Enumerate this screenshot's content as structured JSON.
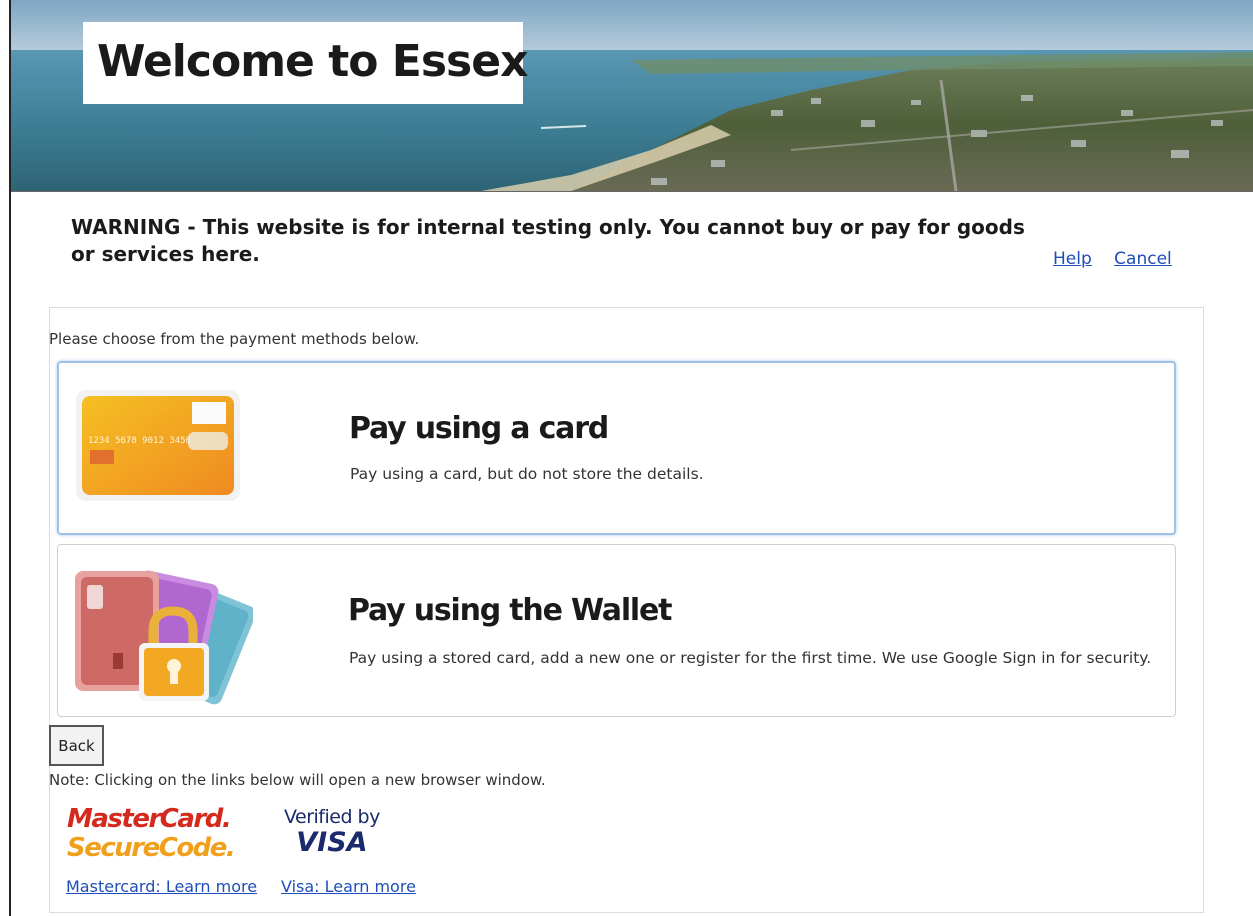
{
  "banner": {
    "title": "Welcome to Essex"
  },
  "warning": {
    "text": "WARNING - This website is for internal testing only. You cannot buy or pay for goods or services here."
  },
  "top_links": {
    "help": "Help",
    "cancel": "Cancel"
  },
  "payment": {
    "intro": "Please choose from the payment methods below.",
    "options": [
      {
        "title": "Pay using a card",
        "description": "Pay using a card, but do not store the details.",
        "icon": "credit-card-icon",
        "card_number_text": "1234 5678 9012 3456"
      },
      {
        "title": "Pay using the Wallet",
        "description": "Pay using a stored card, add a new one or register for the first time. We use Google Sign in for security.",
        "icon": "wallet-lock-icon"
      }
    ]
  },
  "back_button": {
    "label": "Back"
  },
  "note": {
    "text": "Note: Clicking on the links below will open a new browser window."
  },
  "logos": {
    "mastercard": {
      "line1": "MasterCard.",
      "line2": "SecureCode."
    },
    "visa": {
      "line1": "Verified by",
      "line2": "VISA"
    }
  },
  "bottom_links": {
    "mastercard": "Mastercard: Learn more",
    "visa": "Visa: Learn more"
  },
  "colors": {
    "link": "#1f4db8",
    "selected_border": "#9ec3e6",
    "mastercard_red": "#d42a1e",
    "mastercard_orange": "#f0a01c",
    "visa_blue": "#1a2a6c"
  }
}
